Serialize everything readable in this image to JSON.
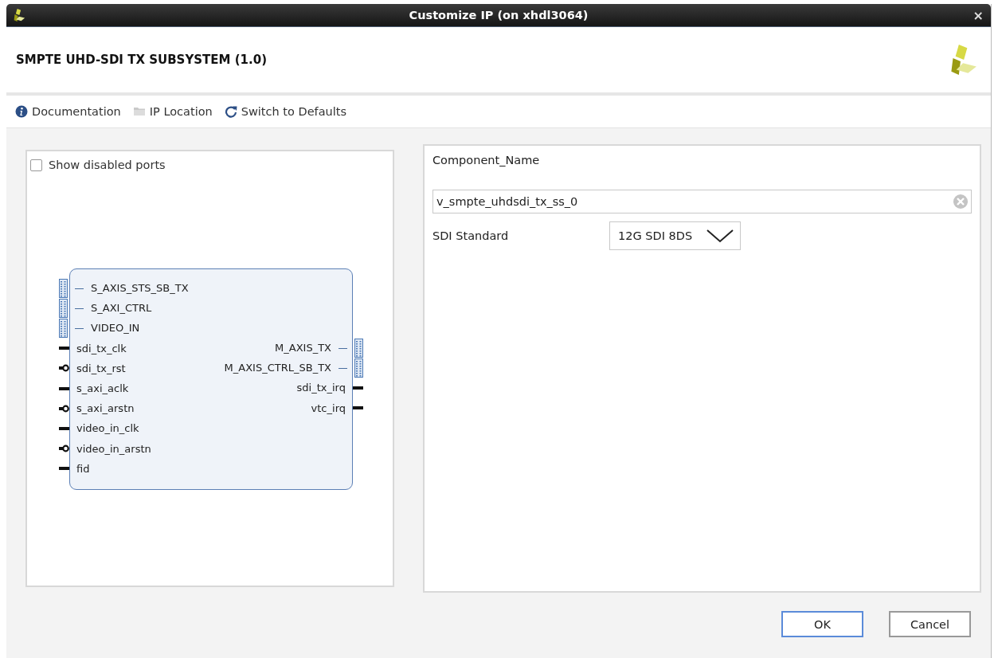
{
  "window": {
    "title": "Customize IP (on xhdl3064)",
    "close": "×"
  },
  "header": {
    "title": "SMPTE UHD-SDI TX SUBSYSTEM (1.0)"
  },
  "toolbar": [
    {
      "label": "Documentation",
      "kind": "info"
    },
    {
      "label": "IP Location",
      "kind": "folder"
    },
    {
      "label": "Switch to Defaults",
      "kind": "refresh"
    }
  ],
  "symbol_panel": {
    "show_disabled_ports": {
      "label": "Show disabled ports",
      "checked": false
    },
    "left_ports": [
      {
        "name": "S_AXIS_STS_SB_TX",
        "kind": "bus"
      },
      {
        "name": "S_AXI_CTRL",
        "kind": "bus"
      },
      {
        "name": "VIDEO_IN",
        "kind": "bus"
      },
      {
        "name": "sdi_tx_clk",
        "kind": "wire"
      },
      {
        "name": "sdi_tx_rst",
        "kind": "inverted"
      },
      {
        "name": "s_axi_aclk",
        "kind": "wire"
      },
      {
        "name": "s_axi_arstn",
        "kind": "inverted"
      },
      {
        "name": "video_in_clk",
        "kind": "wire"
      },
      {
        "name": "video_in_arstn",
        "kind": "inverted"
      },
      {
        "name": "fid",
        "kind": "wire"
      }
    ],
    "right_ports": [
      {
        "name": "M_AXIS_TX",
        "kind": "bus"
      },
      {
        "name": "M_AXIS_CTRL_SB_TX",
        "kind": "bus"
      },
      {
        "name": "sdi_tx_irq",
        "kind": "wire"
      },
      {
        "name": "vtc_irq",
        "kind": "wire"
      }
    ]
  },
  "settings": {
    "component_name": {
      "label": "Component_Name",
      "value": "v_smpte_uhdsdi_tx_ss_0"
    },
    "sdi_standard": {
      "label": "SDI Standard",
      "value": "12G SDI 8DS"
    }
  },
  "buttons": [
    {
      "label": "OK",
      "default": true
    },
    {
      "label": "Cancel",
      "default": false
    }
  ]
}
